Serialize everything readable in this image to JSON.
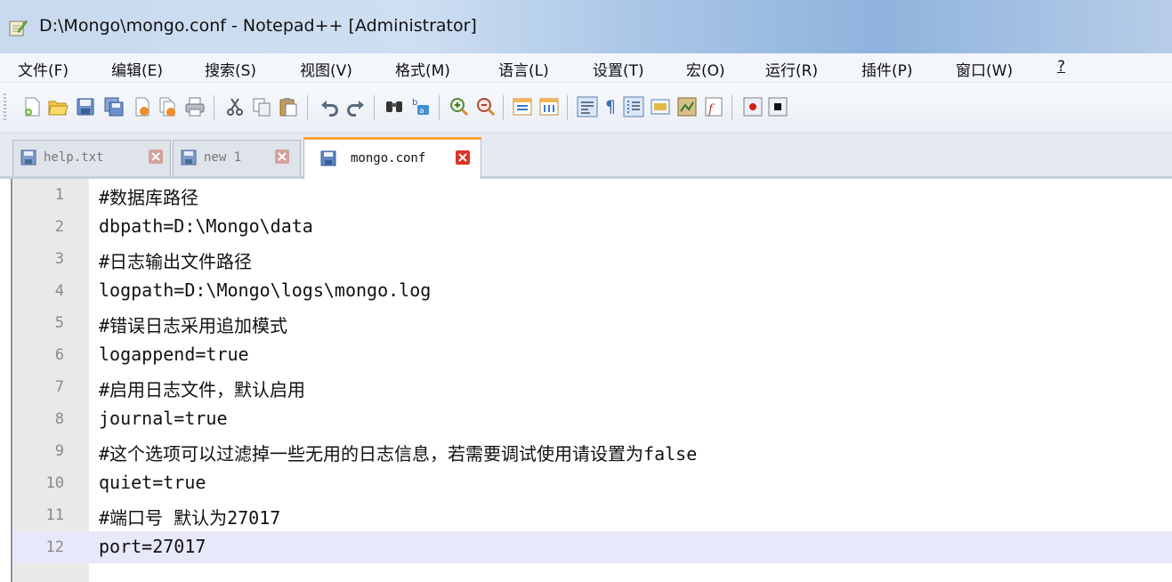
{
  "window": {
    "title": "D:\\Mongo\\mongo.conf - Notepad++ [Administrator]",
    "icon": "notepadpp-icon"
  },
  "menu": [
    "文件(F)",
    "编辑(E)",
    "搜索(S)",
    "视图(V)",
    "格式(M)",
    "语言(L)",
    "设置(T)",
    "宏(O)",
    "运行(R)",
    "插件(P)",
    "窗口(W)",
    "?"
  ],
  "toolbar": {
    "icons": [
      "new-file-icon",
      "open-file-icon",
      "save-icon",
      "save-all-icon",
      "close-icon",
      "close-all-icon",
      "print-icon",
      "cut-icon",
      "copy-icon",
      "paste-icon",
      "undo-icon",
      "redo-icon",
      "find-icon",
      "replace-icon",
      "zoom-in-icon",
      "zoom-out-icon",
      "sync-vertical-icon",
      "sync-horizontal-icon",
      "word-wrap-icon",
      "show-all-chars-icon",
      "indent-guide-icon",
      "user-defined-lang-icon",
      "doc-map-icon",
      "function-list-icon",
      "record-macro-icon",
      "stop-macro-icon"
    ]
  },
  "tabs": [
    {
      "label": "help.txt",
      "active": false
    },
    {
      "label": "new  1",
      "active": false
    },
    {
      "label": "mongo.conf",
      "active": true
    }
  ],
  "editor": {
    "current_line": 12,
    "lines": [
      {
        "num": "1",
        "text": "#数据库路径"
      },
      {
        "num": "2",
        "text": "dbpath=D:\\Mongo\\data"
      },
      {
        "num": "3",
        "text": "#日志输出文件路径"
      },
      {
        "num": "4",
        "text": "logpath=D:\\Mongo\\logs\\mongo.log"
      },
      {
        "num": "5",
        "text": "#错误日志采用追加模式"
      },
      {
        "num": "6",
        "text": "logappend=true"
      },
      {
        "num": "7",
        "text": "#启用日志文件，默认启用"
      },
      {
        "num": "8",
        "text": "journal=true"
      },
      {
        "num": "9",
        "text": "#这个选项可以过滤掉一些无用的日志信息，若需要调试使用请设置为false"
      },
      {
        "num": "10",
        "text": "quiet=true"
      },
      {
        "num": "11",
        "text": "#端口号 默认为27017"
      },
      {
        "num": "12",
        "text": "port=27017"
      }
    ]
  },
  "colors": {
    "active_tab_accent": "#f7a53b",
    "current_line_bg": "#e8e8fb",
    "gutter_bg": "#e9e9e9",
    "tab_close": "#d9342b"
  }
}
